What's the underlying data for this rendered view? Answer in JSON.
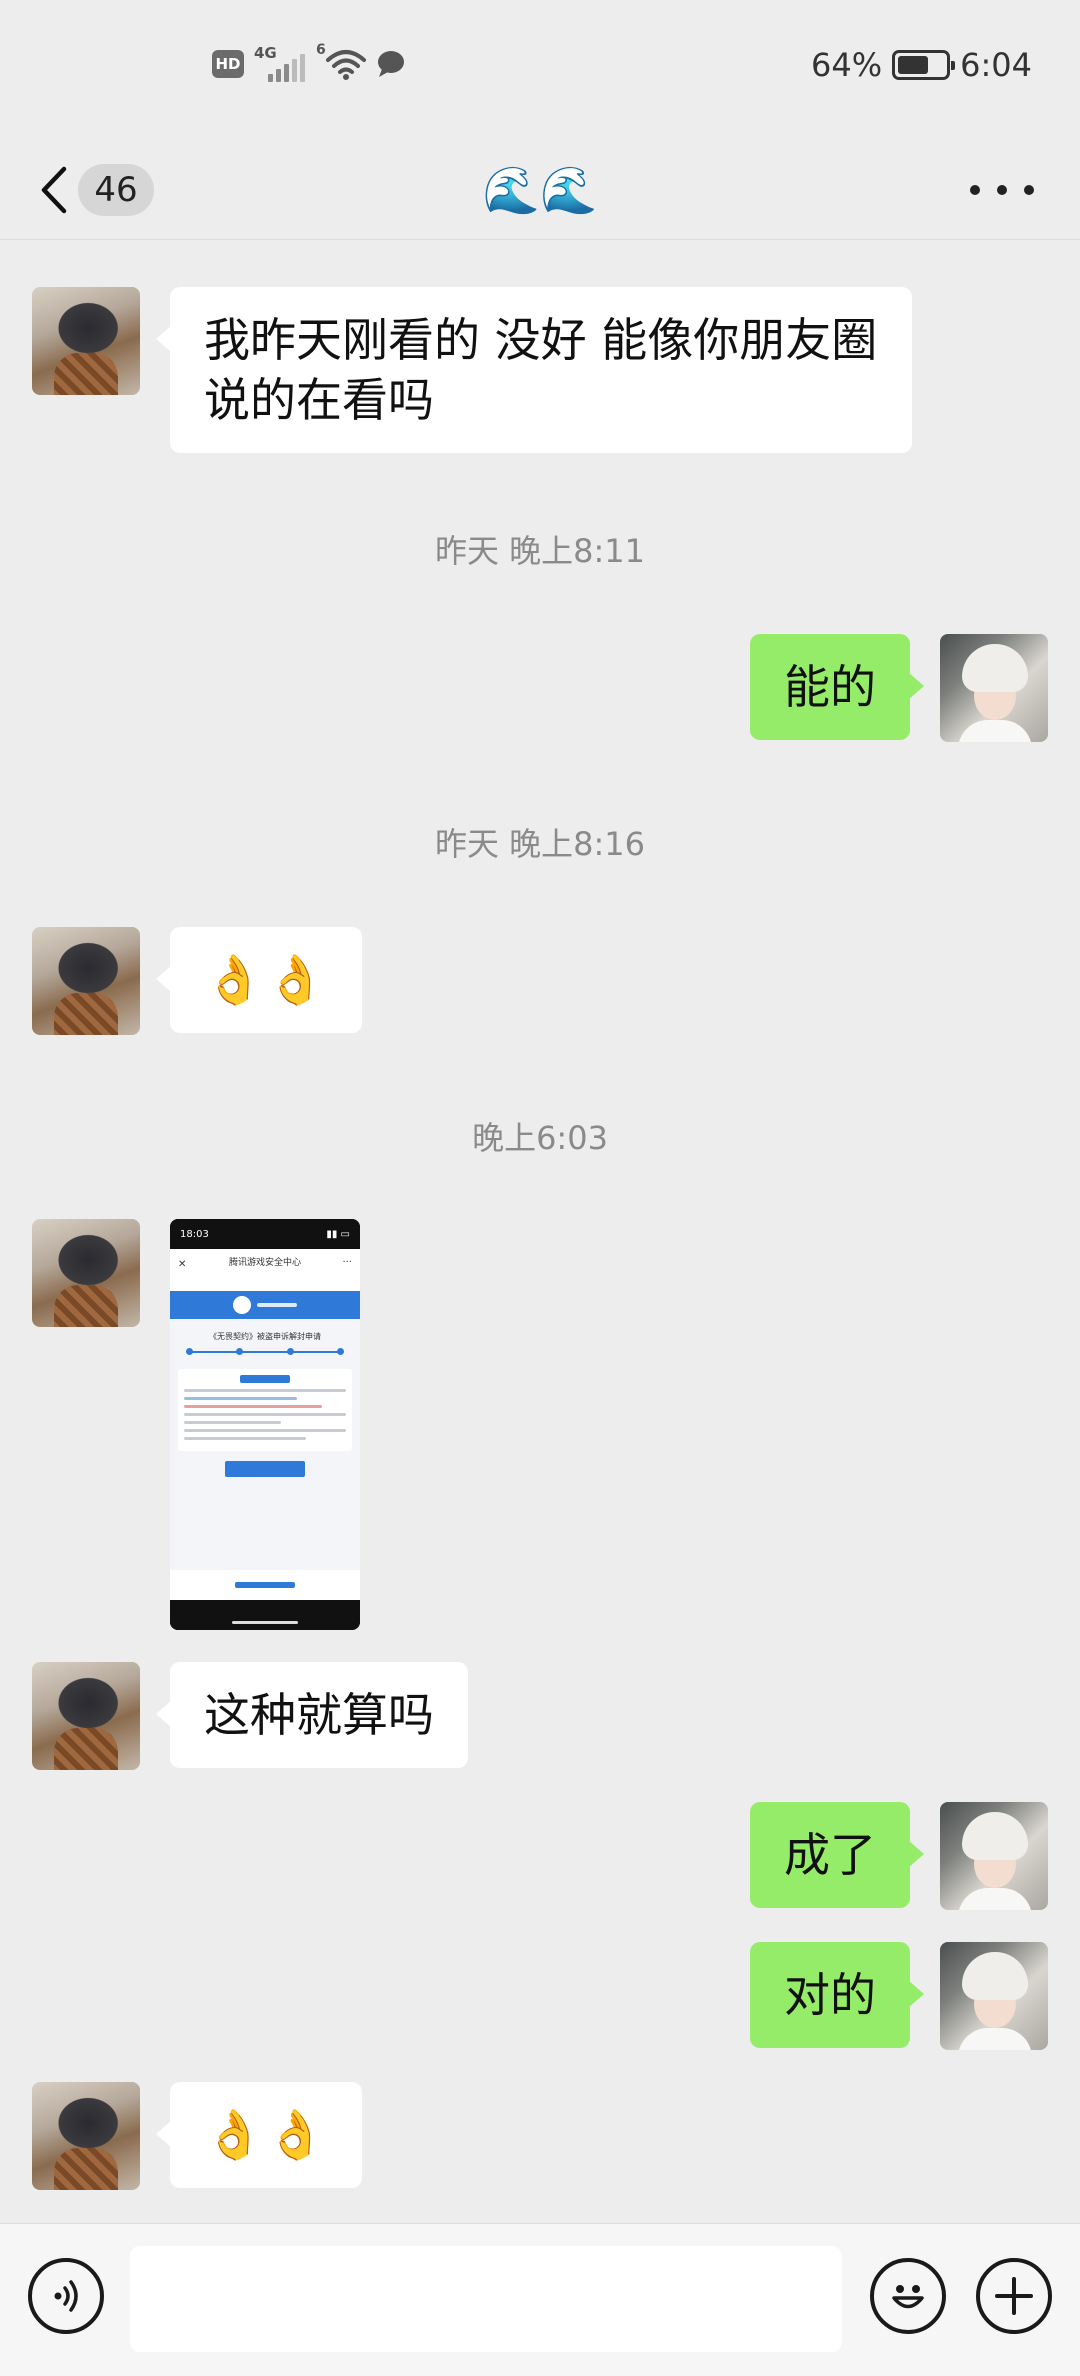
{
  "status_bar": {
    "hd": "HD",
    "network": "4G",
    "wifi_badge": "6",
    "battery_text": "64%",
    "battery_level": 0.64,
    "time": "6:04"
  },
  "nav": {
    "unread_count": "46",
    "title": "🌊🌊"
  },
  "messages": {
    "m1": "我昨天刚看的 没好  能像你朋友圈说的在看吗",
    "t1": "昨天 晚上8:11",
    "m2": "能的",
    "t2": "昨天 晚上8:16",
    "m3": "👌👌",
    "t3": "晚上6:03",
    "img": {
      "time": "18:03",
      "header": "腾讯游戏安全中心",
      "title": "《无畏契约》被盗申诉解封申请"
    },
    "m5": "这种就算吗",
    "m6": "成了",
    "m7": "对的",
    "m8": "👌👌"
  },
  "input": {
    "placeholder": ""
  }
}
